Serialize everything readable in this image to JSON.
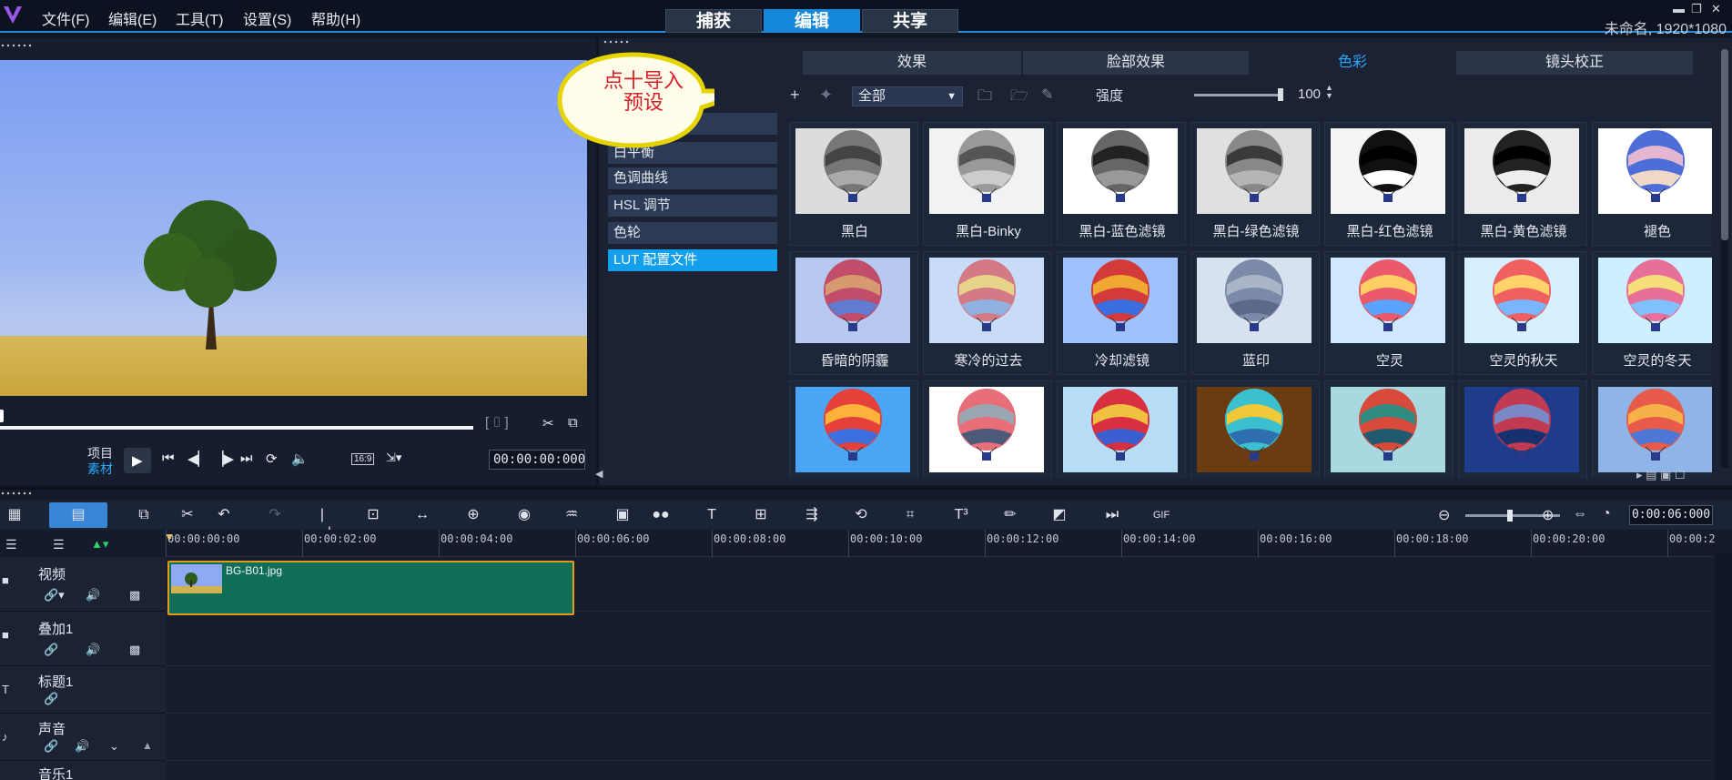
{
  "menu": {
    "items": [
      "文件(F)",
      "编辑(E)",
      "工具(T)",
      "设置(S)",
      "帮助(H)"
    ]
  },
  "modes": [
    "捕获",
    "编辑",
    "共享"
  ],
  "active_mode": "编辑",
  "project": {
    "info": "未命名, 1920*1080"
  },
  "player": {
    "project_label": "项目",
    "clip_label": "素材",
    "aspect_label": "16:9",
    "timecode": "00:00:00:000"
  },
  "effects": {
    "tabs": [
      "效果",
      "脸部效果",
      "色彩",
      "镜头校正"
    ],
    "active_tab": "色彩",
    "callout": [
      "点十导入",
      "预设"
    ],
    "categories": [
      "白平衡",
      "色调曲线",
      "HSL 调节",
      "色轮",
      "LUT 配置文件"
    ],
    "active_category": "LUT 配置文件",
    "filter_dropdown": "全部",
    "strength_label": "强度",
    "strength_value": "100",
    "presets": [
      "黑白",
      "黑白-Binky",
      "黑白-蓝色滤镜",
      "黑白-绿色滤镜",
      "黑白-红色滤镜",
      "黑白-黄色滤镜",
      "褪色",
      "昏暗的阴霾",
      "寒冷的过去",
      "冷却滤镜",
      "蓝印",
      "空灵",
      "空灵的秋天",
      "空灵的冬天",
      "",
      "",
      "",
      "",
      "",
      "",
      ""
    ]
  },
  "timeline": {
    "timecode": "0:00:06:000",
    "ruler": [
      "00:00:00:00",
      "00:00:02:00",
      "00:00:04:00",
      "00:00:06:00",
      "00:00:08:00",
      "00:00:10:00",
      "00:00:12:00",
      "00:00:14:00",
      "00:00:16:00",
      "00:00:18:00",
      "00:00:20:00",
      "00:00:2"
    ],
    "tracks": [
      "视频",
      "叠加1",
      "标题1",
      "声音",
      "音乐1"
    ],
    "clip_name": "BG-B01.jpg"
  },
  "colors": {
    "accent": "#1588d9",
    "active_text": "#2aa9ff",
    "clip_fill": "#0f6e57",
    "clip_border": "#e39b1b",
    "callout_border": "#e6d400"
  }
}
